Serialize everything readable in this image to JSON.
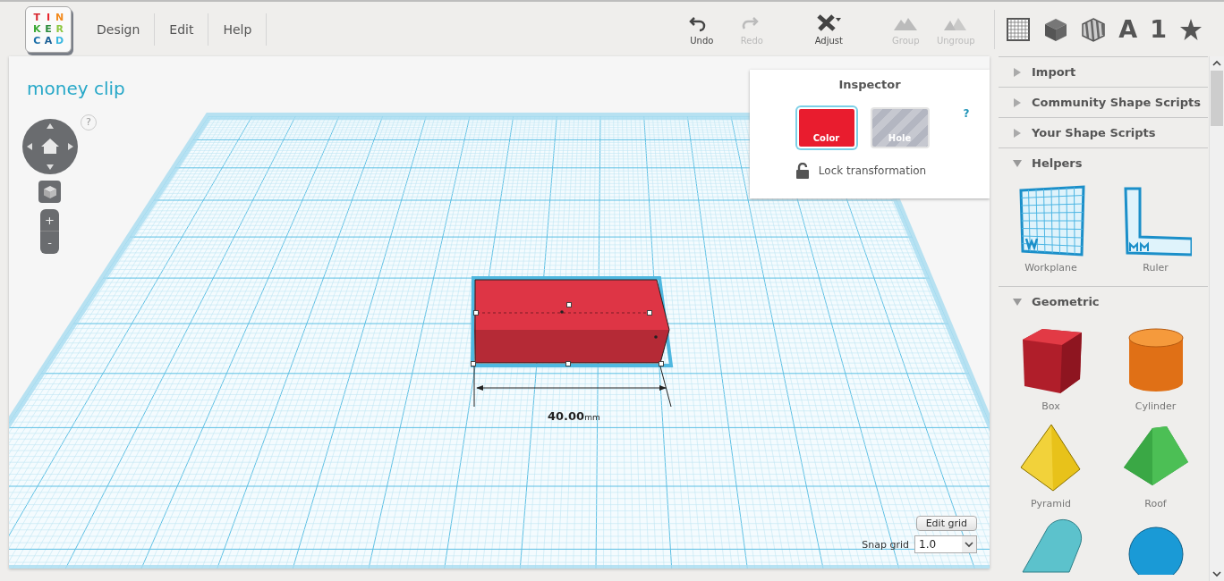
{
  "logo": {
    "letters": [
      {
        "char": "T",
        "color": "#d7262e"
      },
      {
        "char": "I",
        "color": "#e8262e"
      },
      {
        "char": "N",
        "color": "#f28a1d"
      },
      {
        "char": "K",
        "color": "#3aa935"
      },
      {
        "char": "E",
        "color": "#2a8a3a"
      },
      {
        "char": "R",
        "color": "#8cc63e"
      },
      {
        "char": "C",
        "color": "#1a6ea8"
      },
      {
        "char": "A",
        "color": "#1a5f96"
      },
      {
        "char": "D",
        "color": "#3cb8e0"
      }
    ]
  },
  "menu": [
    "Design",
    "Edit",
    "Help"
  ],
  "toolbar": [
    {
      "label": "Undo",
      "kind": "undo",
      "disabled": false
    },
    {
      "label": "Redo",
      "kind": "redo",
      "disabled": true
    },
    {
      "label": "Adjust",
      "kind": "adjust",
      "disabled": false
    },
    {
      "label": "Group",
      "kind": "group",
      "disabled": true
    },
    {
      "label": "Ungroup",
      "kind": "ungroup",
      "disabled": true
    }
  ],
  "view_tools": [
    {
      "kind": "grid"
    },
    {
      "kind": "box"
    },
    {
      "kind": "hole-box"
    },
    {
      "kind": "text",
      "label": "A"
    },
    {
      "kind": "text",
      "label": "1"
    },
    {
      "kind": "star"
    }
  ],
  "workspace": {
    "title": "money clip",
    "help": "?",
    "zoom_in": "+",
    "zoom_out": "-",
    "dimension": {
      "value": "40.00",
      "unit": "mm"
    },
    "edit_grid": "Edit grid",
    "snap_grid": {
      "label": "Snap grid",
      "value": "1.0"
    }
  },
  "inspector": {
    "title": "Inspector",
    "help": "?",
    "options": [
      {
        "label": "Color",
        "kind": "color",
        "selected": true
      },
      {
        "label": "Hole",
        "kind": "hole",
        "selected": false
      }
    ],
    "lock": {
      "label": "Lock transformation",
      "locked": false
    }
  },
  "sidebar": {
    "sections": [
      {
        "title": "Import",
        "expanded": false
      },
      {
        "title": "Community Shape Scripts",
        "expanded": false
      },
      {
        "title": "Your Shape Scripts",
        "expanded": false
      },
      {
        "title": "Helpers",
        "expanded": true,
        "items": [
          {
            "label": "Workplane",
            "kind": "workplane"
          },
          {
            "label": "Ruler",
            "kind": "ruler"
          }
        ]
      },
      {
        "title": "Geometric",
        "expanded": true,
        "items": [
          {
            "label": "Box",
            "kind": "box"
          },
          {
            "label": "Cylinder",
            "kind": "cylinder"
          },
          {
            "label": "Pyramid",
            "kind": "pyramid"
          },
          {
            "label": "Roof",
            "kind": "roof"
          },
          {
            "kind": "round-roof"
          },
          {
            "kind": "sphere"
          }
        ]
      }
    ]
  }
}
